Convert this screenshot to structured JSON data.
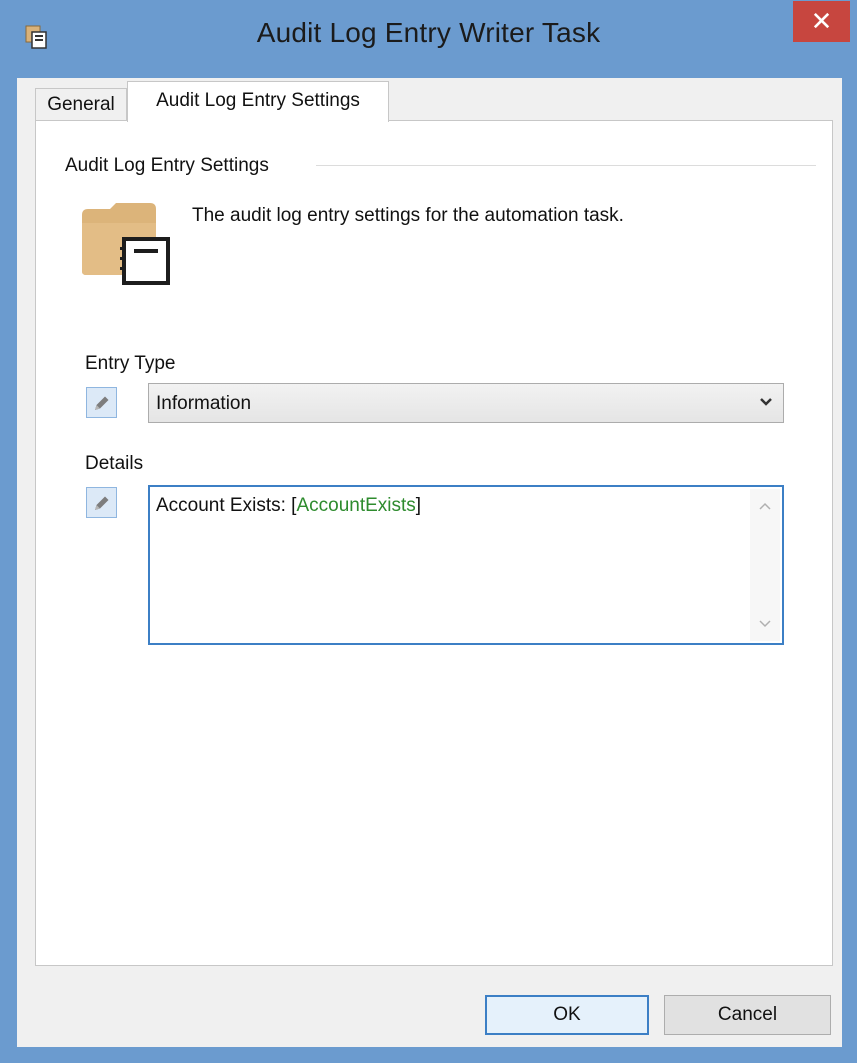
{
  "window": {
    "title": "Audit Log Entry Writer Task",
    "close_symbol": "✕",
    "app_icon": "task-window-icon"
  },
  "tabs": [
    {
      "label": "General",
      "active": false
    },
    {
      "label": "Audit Log Entry Settings",
      "active": true
    }
  ],
  "panel": {
    "group_title": "Audit Log Entry Settings",
    "description": "The audit log entry settings for the automation task.",
    "icon": "folder-notebook-icon"
  },
  "entry_type": {
    "label": "Entry Type",
    "selected": "Information"
  },
  "details": {
    "label": "Details",
    "text_prefix": "Account Exists: [",
    "variable": "AccountExists",
    "text_suffix": "]"
  },
  "buttons": {
    "ok": "OK",
    "cancel": "Cancel"
  },
  "colors": {
    "title_bar": "#6b9bcf",
    "close_button": "#c7463f",
    "focus_border": "#3c7fc5",
    "variable_text": "#2e8b2e",
    "folder": "#dcb47a"
  }
}
